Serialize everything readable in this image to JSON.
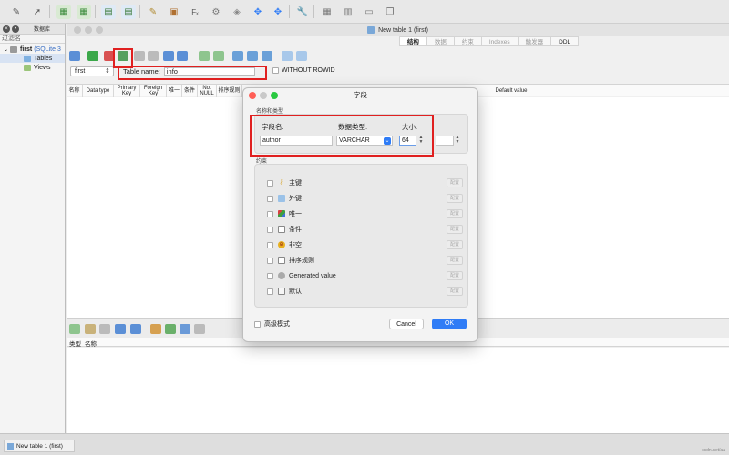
{
  "toolbar": {
    "icons": [
      "pen-icon",
      "rocket-icon",
      "db-add-icon",
      "db-remove-icon",
      "table-add-icon",
      "table-edit-icon",
      "notepad-icon",
      "import-icon",
      "function-icon",
      "gear-icon",
      "cube-icon",
      "cross-arrows-icon",
      "cross-arrows-blue-icon",
      "wrench-icon",
      "grid-icon",
      "layout-icon",
      "window-icon",
      "copy-icon"
    ]
  },
  "sidebar": {
    "header_title": "数据库",
    "filter_label": "过滤名",
    "tree": [
      {
        "label": "first",
        "suffix": "(SQLite 3",
        "level": 0
      },
      {
        "label": "Tables",
        "level": 1
      },
      {
        "label": "Views",
        "level": 1
      }
    ]
  },
  "main": {
    "window_title": "New table 1 (first)",
    "tabs": [
      {
        "label": "结构",
        "active": true
      },
      {
        "label": "数据",
        "active": false
      },
      {
        "label": "约束",
        "active": false
      },
      {
        "label": "Indexes",
        "active": false
      },
      {
        "label": "触发器",
        "active": false
      },
      {
        "label": "DDL",
        "active": false
      }
    ],
    "schema_select": "first",
    "table_name_label": "Table name:",
    "table_name_value": "info",
    "without_rowid_label": "WITHOUT ROWID",
    "columns": [
      "名称",
      "Data type",
      "Primary Key",
      "Foreign Key",
      "唯一",
      "条件",
      "Not NULL",
      "排序规则",
      "Default value"
    ],
    "lower_columns": [
      "类型",
      "名称"
    ]
  },
  "dock": {
    "item_label": "New table 1 (first)",
    "right_text": "csdn.net/aa"
  },
  "dialog": {
    "title": "字段",
    "section_name_type": "名称和类型",
    "field_name_label": "字段名:",
    "field_name_value": "author",
    "data_type_label": "数据类型:",
    "data_type_value": "VARCHAR",
    "size_label": "大小:",
    "size_value": "64",
    "size2_value": "",
    "section_constraints": "约束",
    "constraints": [
      {
        "label": "主键",
        "icon": "key-icon",
        "set": "配置"
      },
      {
        "label": "外键",
        "icon": "foreign-key-icon",
        "set": "配置"
      },
      {
        "label": "唯一",
        "icon": "unique-icon",
        "set": "配置"
      },
      {
        "label": "条件",
        "icon": "condition-icon",
        "set": "配置"
      },
      {
        "label": "非空",
        "icon": "not-null-icon",
        "set": "配置"
      },
      {
        "label": "排序规则",
        "icon": "collation-icon",
        "set": "配置"
      },
      {
        "label": "Generated value",
        "icon": "generated-icon",
        "set": "配置"
      },
      {
        "label": "默认",
        "icon": "default-icon",
        "set": "配置"
      }
    ],
    "advanced_label": "高级模式",
    "cancel_label": "Cancel",
    "ok_label": "OK"
  },
  "colors": {
    "accent": "#2f7cf6",
    "highlight": "#e02020"
  }
}
